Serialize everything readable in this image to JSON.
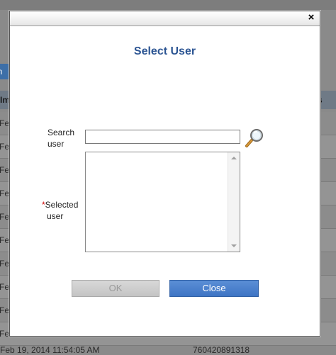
{
  "background": {
    "tab_label": "gn",
    "column_header_left": "Im",
    "column_header_right": "s",
    "row_prefix": "Fe",
    "bottom_date": "Feb 19, 2014 11:54:05 AM",
    "bottom_number": "760420891318"
  },
  "dialog": {
    "title": "Select User",
    "close_glyph": "×",
    "search_label_line1": "Search",
    "search_label_line2": "user",
    "search_value": "",
    "selected_label_required_mark": "*",
    "selected_label_line1": "Selected",
    "selected_label_line2": "user",
    "selected_users": [],
    "ok_label": "OK",
    "close_label": "Close"
  },
  "icons": {
    "search": "magnifier-icon",
    "close": "close-icon"
  }
}
